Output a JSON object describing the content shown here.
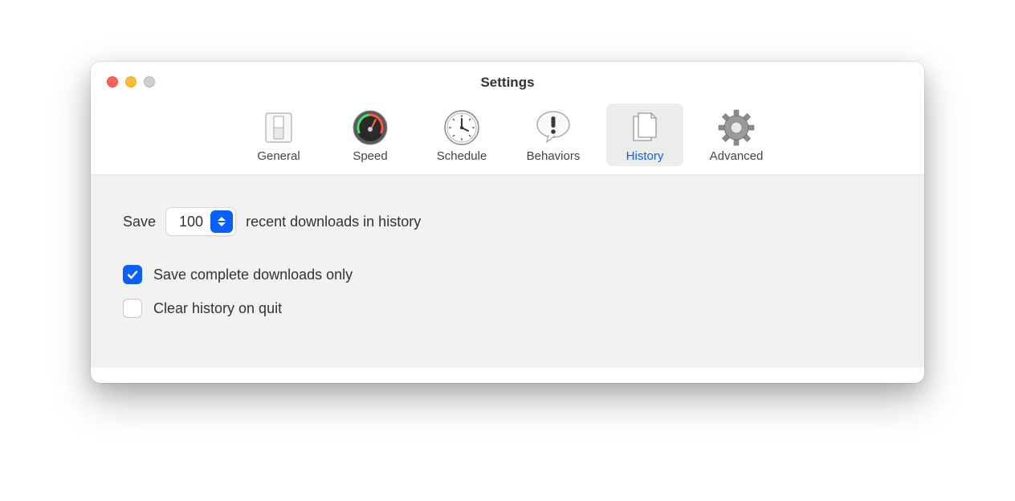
{
  "window": {
    "title": "Settings"
  },
  "tabs": [
    {
      "label": "General"
    },
    {
      "label": "Speed"
    },
    {
      "label": "Schedule"
    },
    {
      "label": "Behaviors"
    },
    {
      "label": "History"
    },
    {
      "label": "Advanced"
    }
  ],
  "history": {
    "save_prefix": "Save",
    "save_count": "100",
    "save_suffix": "recent downloads in history",
    "checkbox_complete_label": "Save complete downloads only",
    "checkbox_complete_checked": true,
    "checkbox_clear_label": "Clear history on quit",
    "checkbox_clear_checked": false
  }
}
